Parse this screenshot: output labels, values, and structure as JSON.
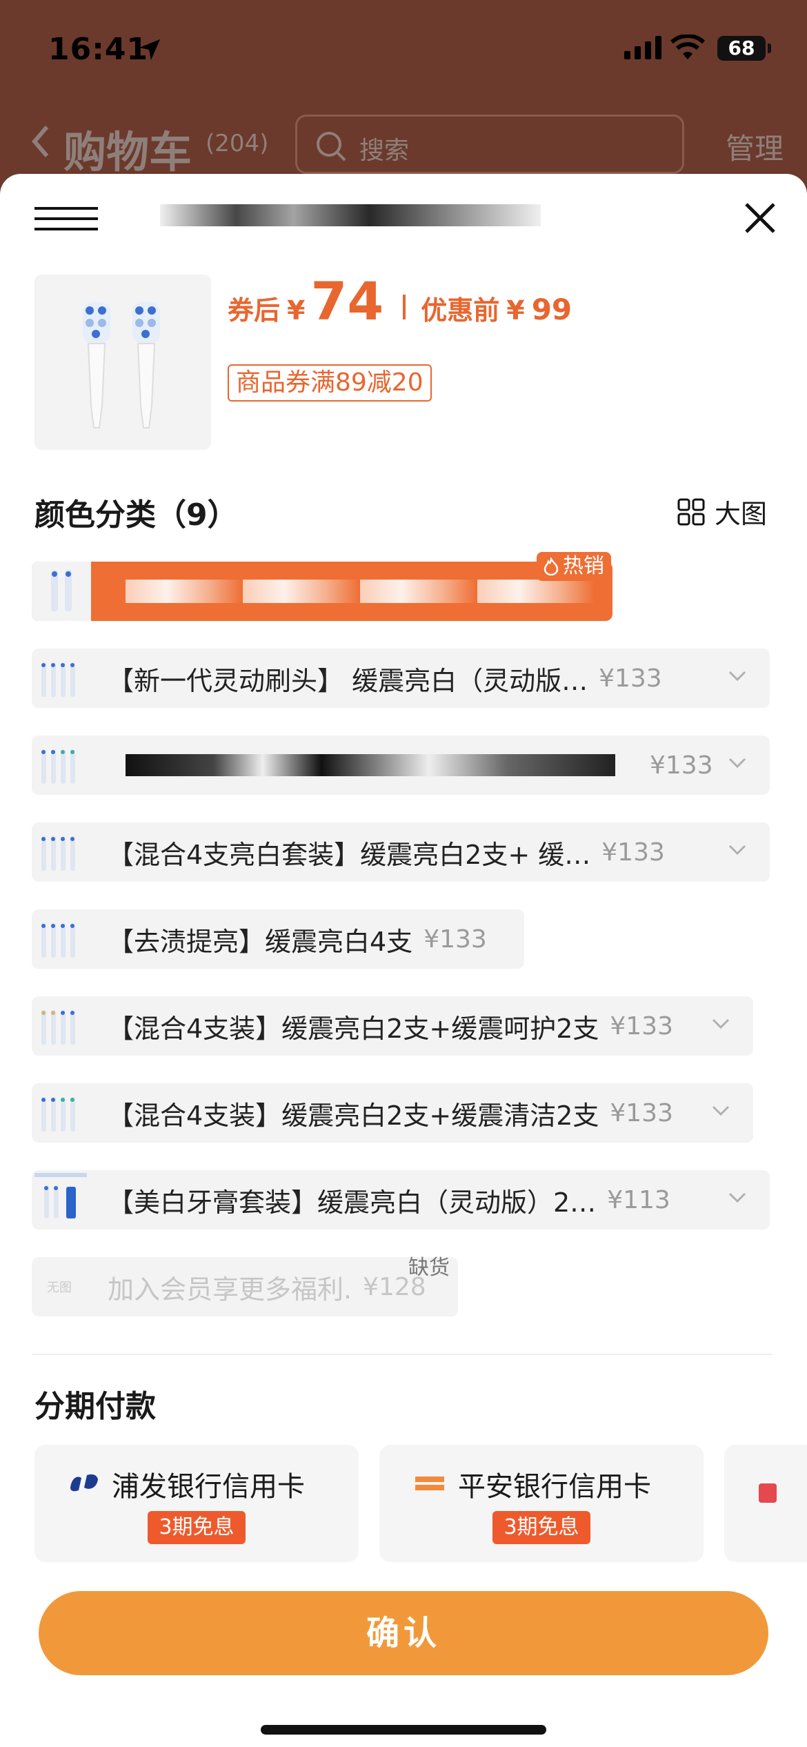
{
  "status_bar": {
    "time": "16:41",
    "battery": "68"
  },
  "nav": {
    "title": "购物车",
    "count": "(204)",
    "search_placeholder": "搜索",
    "manage": "管理"
  },
  "product": {
    "after_label": "券后",
    "currency": "¥",
    "price_after": "74",
    "before_label": "优惠前",
    "price_before": "99",
    "coupon": "商品券满89减20"
  },
  "colors_section": {
    "title": "颜色分类（9）",
    "bigview": "大图"
  },
  "variants": [
    {
      "label": "",
      "price": "",
      "badge": "热销",
      "selected": true
    },
    {
      "label": "【新一代灵动刷头】 缓震亮白（灵动版…",
      "price": "¥133"
    },
    {
      "label": "",
      "price": "¥133"
    },
    {
      "label": "【混合4支亮白套装】缓震亮白2支+ 缓…",
      "price": "¥133"
    },
    {
      "label": "【去渍提亮】缓震亮白4支",
      "price": "¥133"
    },
    {
      "label": "【混合4支装】缓震亮白2支+缓震呵护2支",
      "price": "¥133"
    },
    {
      "label": "【混合4支装】缓震亮白2支+缓震清洁2支",
      "price": "¥133"
    },
    {
      "label": "【美白牙膏套装】缓震亮白（灵动版）2…",
      "price": "¥113"
    },
    {
      "label": "加入会员享更多福利.",
      "price": "¥128",
      "no_image": "无图",
      "status": "缺货",
      "disabled": true
    }
  ],
  "installments": {
    "title": "分期付款",
    "cards": [
      {
        "bank": "浦发银行信用卡",
        "tag": "3期免息"
      },
      {
        "bank": "平安银行信用卡",
        "tag": "3期免息"
      }
    ]
  },
  "confirm_label": "确认",
  "colors": {
    "accent": "#ee6e34",
    "button": "#f1993a",
    "price": "#e8662f",
    "backdrop": "#6b3a2c"
  }
}
